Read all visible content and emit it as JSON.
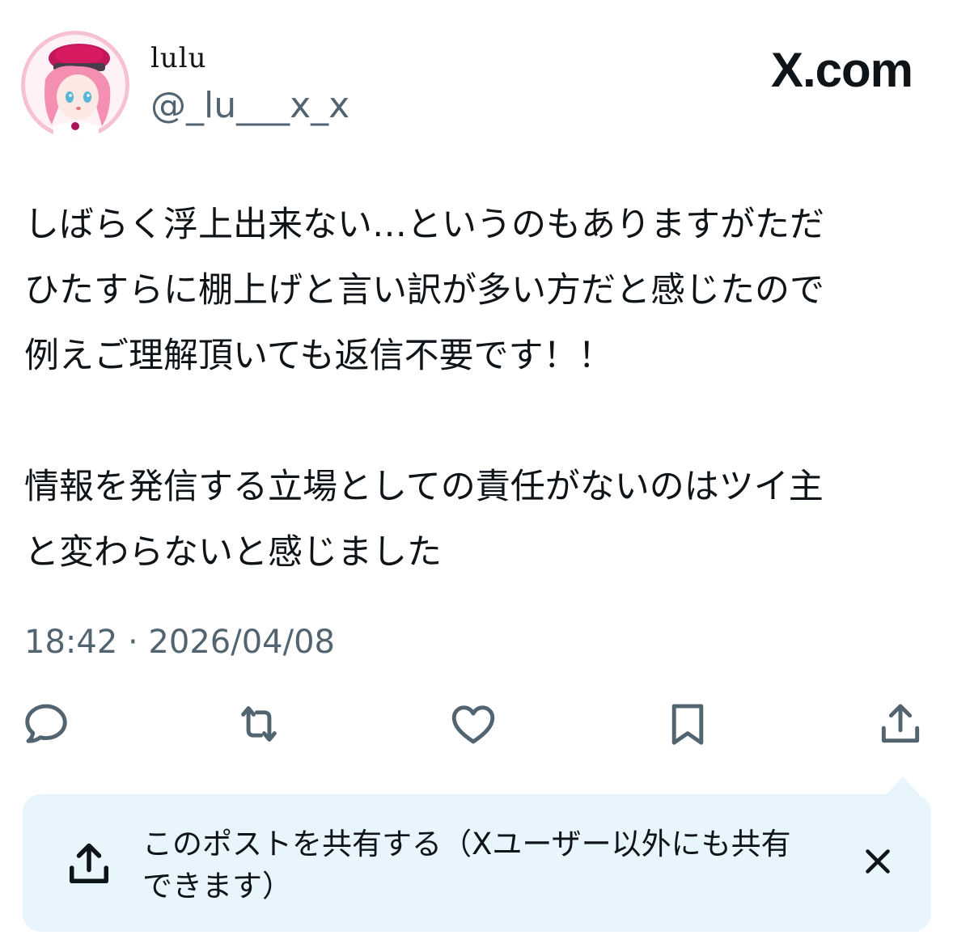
{
  "author": {
    "display_name": "lulu",
    "handle": "@_lu___x_x",
    "avatar_icon": "anime-character-avatar"
  },
  "brand": {
    "label": "X.com"
  },
  "tweet": {
    "text": "しばらく浮上出来ない…というのもありますがただ\nひたすらに棚上げと言い訳が多い方だと感じたので\n例えご理解頂いても返信不要です！！\n\n情報を発信する立場としての責任がないのはツイ主\nと変わらないと感じました",
    "timestamp": "18:42 · 2026/04/08"
  },
  "actions": [
    {
      "name": "reply",
      "icon": "reply-icon"
    },
    {
      "name": "repost",
      "icon": "repost-icon"
    },
    {
      "name": "like",
      "icon": "heart-icon"
    },
    {
      "name": "bookmark",
      "icon": "bookmark-icon"
    },
    {
      "name": "share",
      "icon": "share-icon"
    }
  ],
  "share_banner": {
    "text": "このポストを共有する（Xユーザー以外にも共有\nできます）",
    "icon": "share-icon",
    "close_icon": "close-icon"
  },
  "colors": {
    "text_primary": "#0f1419",
    "text_secondary": "#536471",
    "banner_bg": "#e8f5fd"
  }
}
